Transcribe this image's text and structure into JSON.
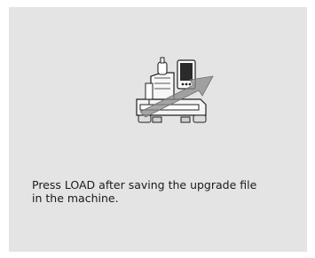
{
  "illustration": {
    "icon": "embroidery-machine-upgrade-icon",
    "arrow_color": "#7f7f7f",
    "screen_color": "#2b2b2b"
  },
  "message": {
    "line1": "Press LOAD after saving the upgrade file",
    "line2": "in the machine."
  }
}
